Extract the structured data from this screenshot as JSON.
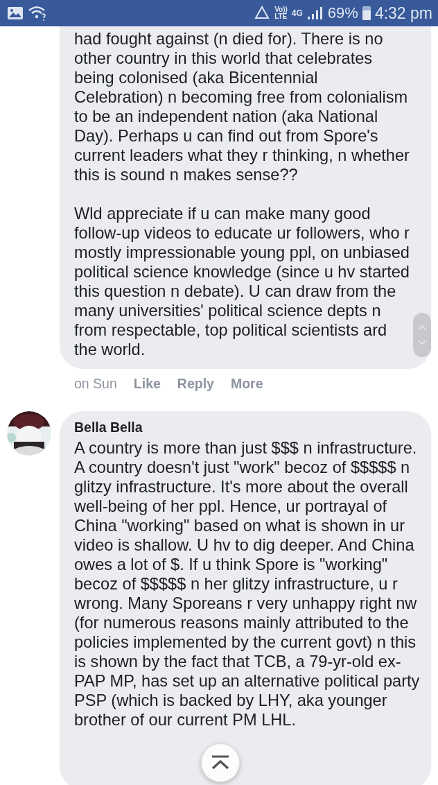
{
  "status_bar": {
    "volte_top": "Vo))",
    "volte_bottom": "LTE",
    "network": "4G",
    "battery": "69%",
    "time": "4:32 pm"
  },
  "comments": [
    {
      "kind": "continuation",
      "paragraphs": [
        "had fought against (n died for). There is no other country in this world that celebrates being colonised (aka Bicentennial Celebration) n becoming free from colonialism to be an independent nation (aka National Day). Perhaps u can find out from Spore's current leaders what they r thinking, n whether this is sound n makes sense??",
        "Wld appreciate if u can make many good follow-up videos to educate ur followers, who r mostly impressionable young ppl, on unbiased political science knowledge (since u hv started this question n debate). U can draw from the many universities' political science depts n from respectable, top political scientists ard the world."
      ],
      "time": "on Sun",
      "actions": [
        "Like",
        "Reply",
        "More"
      ]
    },
    {
      "kind": "full",
      "author": "Bella Bella",
      "paragraphs": [
        "A country is more than just $$$ n infrastructure. A country doesn't just \"work\" becoz of $$$$$ n glitzy infrastructure. It's more about the overall well-being of her ppl. Hence, ur portrayal of China \"working\" based on what is shown in ur video is shallow. U hv to dig deeper. And China owes a lot of $. If u think Spore is \"working\" becoz of $$$$$ n her glitzy infrastructure, u r wrong. Many Sporeans r very unhappy right nw (for numerous reasons mainly attributed to the policies implemented by the current govt) n this is shown by the fact that TCB, a 79-yr-old ex-PAP MP, has set up an alternative political party PSP (which is backed by LHY, aka younger brother of our current PM LHL."
      ]
    }
  ]
}
